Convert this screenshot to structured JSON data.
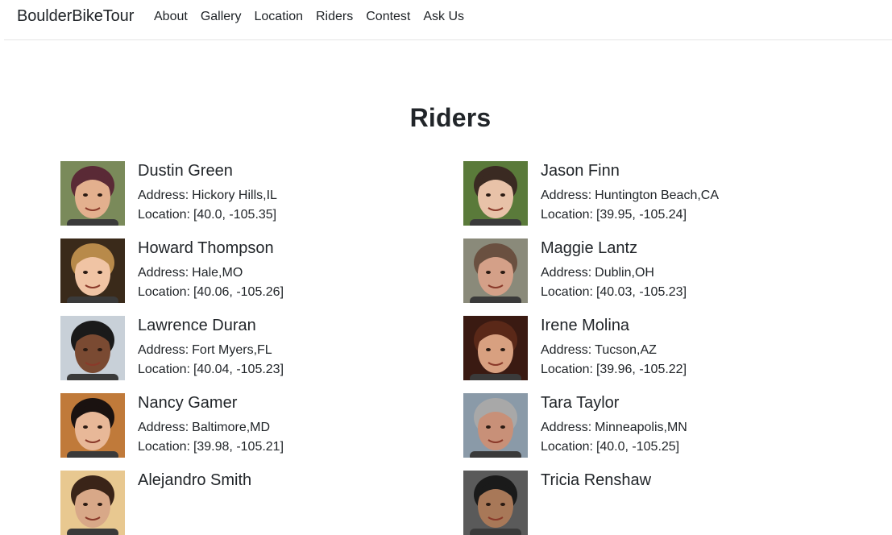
{
  "navbar": {
    "brand": "BoulderBikeTour",
    "links": [
      "About",
      "Gallery",
      "Location",
      "Riders",
      "Contest",
      "Ask Us"
    ]
  },
  "page": {
    "title": "Riders"
  },
  "labels": {
    "address": "Address:",
    "location": "Location:"
  },
  "riders": [
    {
      "name": "Dustin Green",
      "address": "Hickory Hills,IL",
      "location": "[40.0, -105.35]",
      "skin": "#e3b08e",
      "hair": "#5a2a36",
      "bg": "#7a8a5a"
    },
    {
      "name": "Jason Finn",
      "address": "Huntington Beach,CA",
      "location": "[39.95, -105.24]",
      "skin": "#e8c2a8",
      "hair": "#3a2a22",
      "bg": "#5a7a3a"
    },
    {
      "name": "Howard Thompson",
      "address": "Hale,MO",
      "location": "[40.06, -105.26]",
      "skin": "#f0c4a4",
      "hair": "#b88a4a",
      "bg": "#3a2a1a"
    },
    {
      "name": "Maggie Lantz",
      "address": "Dublin,OH",
      "location": "[40.03, -105.23]",
      "skin": "#d4a088",
      "hair": "#6a5040",
      "bg": "#8a8a7a"
    },
    {
      "name": "Lawrence Duran",
      "address": "Fort Myers,FL",
      "location": "[40.04, -105.23]",
      "skin": "#7a4a32",
      "hair": "#1a1a1a",
      "bg": "#c8d0d8"
    },
    {
      "name": "Irene Molina",
      "address": "Tucson,AZ",
      "location": "[39.96, -105.22]",
      "skin": "#d8a080",
      "hair": "#5a2818",
      "bg": "#3a1a12"
    },
    {
      "name": "Nancy Gamer",
      "address": "Baltimore,MD",
      "location": "[39.98, -105.21]",
      "skin": "#e8b898",
      "hair": "#1a1210",
      "bg": "#c07a3a"
    },
    {
      "name": "Tara Taylor",
      "address": "Minneapolis,MN",
      "location": "[40.0, -105.25]",
      "skin": "#c89078",
      "hair": "#a8a8a8",
      "bg": "#8a9aa8"
    },
    {
      "name": "Alejandro Smith",
      "address": "",
      "location": "",
      "skin": "#d8a888",
      "hair": "#3a2418",
      "bg": "#e8c890"
    },
    {
      "name": "Tricia Renshaw",
      "address": "",
      "location": "",
      "skin": "#a87858",
      "hair": "#1a1a1a",
      "bg": "#5a5a5a"
    }
  ]
}
